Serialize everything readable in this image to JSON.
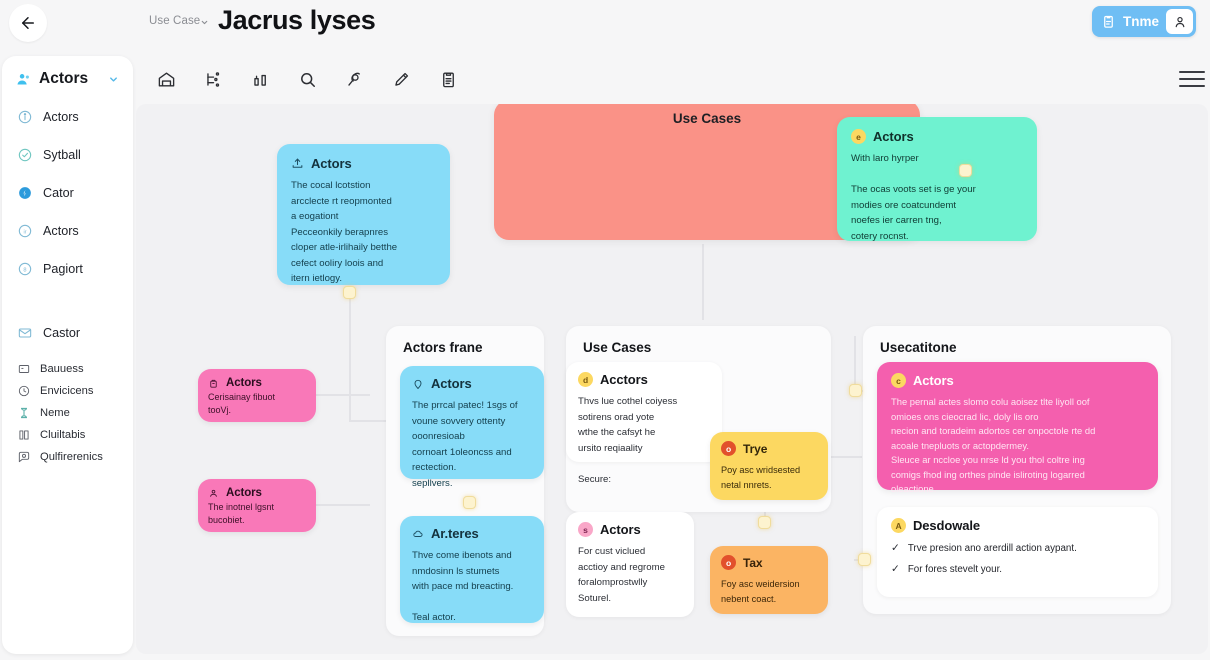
{
  "header": {
    "back_icon": "arrow-left-icon",
    "breadcrumb": "Use Case",
    "breadcrumb_caret": "chevron-down-icon",
    "title": "Jacrus lyses",
    "action_label": "Tnme",
    "action_icon": "clipboard-icon",
    "avatar_icon": "user-icon"
  },
  "toolbar": {
    "icons": [
      "home-icon",
      "sitemap-icon",
      "bar-chart-icon",
      "search-icon",
      "tag-icon",
      "pencil-icon",
      "clipboard-list-icon"
    ],
    "menu_icon": "hamburger-menu-icon"
  },
  "sidebar": {
    "header_label": "Actors",
    "header_icon": "user-group-icon",
    "header_caret": "chevron-down-icon",
    "items": [
      {
        "label": "Actors",
        "icon": "info-circle-icon",
        "active": false
      },
      {
        "label": "Sytball",
        "icon": "check-circle-icon",
        "active": false
      },
      {
        "label": "Cator",
        "icon": "filled-circle-icon",
        "active": true
      },
      {
        "label": "Actors",
        "icon": "letter-circle-icon",
        "active": false
      },
      {
        "label": "Pagiort",
        "icon": "number-circle-icon",
        "active": false
      }
    ],
    "secondary": [
      {
        "label": "Castor",
        "icon": "mail-icon"
      }
    ],
    "tertiary": [
      {
        "label": "Bauuess",
        "icon": "card-icon"
      },
      {
        "label": "Envicicens",
        "icon": "clock-icon"
      },
      {
        "label": "Neme",
        "icon": "hourglass-icon"
      },
      {
        "label": "Cluiltabis",
        "icon": "book-icon"
      },
      {
        "label": "Qulfirerenics",
        "icon": "comment-search-icon"
      }
    ]
  },
  "canvas": {
    "banner": {
      "title": "Use Cases"
    },
    "frames": [
      {
        "title": "Actors frane"
      },
      {
        "title": "Use Cases"
      },
      {
        "title": "Usecatitone"
      }
    ],
    "cards": {
      "blue_top": {
        "title": "Actors",
        "icon": "upload-icon",
        "body": "The cocal lcotstion\narcclecte rt reopmonted\na eogationt\nPecceonkily berapnres\ncloper atle-irlihaily betthe\ncefect ooliry loois and\nitern ietlogy."
      },
      "teal_top": {
        "title": "Actors",
        "icon": "badge-icon",
        "badge_char": "e",
        "body": "With laro hyrper\n\nThe ocas voots set is ge your\nmodies ore coatcundemt\nnoefes ier carren tng,\ncotery rocnst."
      },
      "pink_left_1": {
        "title": "Actors",
        "icon": "bag-icon",
        "body": "Cerisainay fibuot\ntooVj."
      },
      "pink_left_2": {
        "title": "Actors",
        "icon": "person-icon",
        "body": "The inotnel  lgsnt\nbucobiet."
      },
      "blue_mid_1": {
        "title": "Actors",
        "icon": "location-pin-icon",
        "body": "The prrcal patec! 1sgs of\nvoune sovvery ottenty\nooonresioab\ncornoart 1oleoncss and\nrectection.\nsepllvers."
      },
      "blue_mid_2": {
        "title": "Ar.teres",
        "icon": "cloud-icon",
        "body": "Thve come ibenots and\nnmdosinn ls stumets\nwith pace md breacting.\n\nTeal actor."
      },
      "usecase_1": {
        "title": "Acctors",
        "badge_char": "d",
        "body": "Thvs lue cothel coiyess\nsotirens orad yote\nwthe the cafsyt he\nursito reqiaality\n\nSecure:"
      },
      "usecase_2": {
        "title": "Actors",
        "badge_char": "s",
        "body": "For cust viclued\nacctioy and regrome\nforalomprostwlly\nSoturel."
      },
      "yellow_1": {
        "title": "Trye",
        "badge_char": "o",
        "body": "Poy asc wridsested\nnetal nnrets."
      },
      "orange_1": {
        "title": "Tax",
        "badge_char": "o",
        "body": "Foy asc weidersion\nnebent coact."
      },
      "pink_right": {
        "title": "Actors",
        "badge_char": "c",
        "body": "The pernal actes slomo colu aoisez tlte liyoll oof\nomioes ons cieocrad lic, doly lis oro\nnecion and toradeim adortos cer onpoctole rte dd\nacoale tnepluots or actopdermey.\nSleuce ar nccloe you nrse ld you thol coltre ing\ncomigs fhod ing orthes pinde isliroting logarred\noleactione."
      },
      "checklist": {
        "title": "Desdowale",
        "badge_char": "A",
        "items": [
          "Trve presion ano arerdill action aypant.",
          "For fores stevelt your."
        ]
      }
    }
  },
  "colors": {
    "blue": "#87dcf8",
    "teal": "#6ff2d0",
    "pink": "#f978b8",
    "pink_strong": "#f45fae",
    "salmon": "#fa9287",
    "yellow": "#fcd861",
    "orange": "#fbb463",
    "accent_blue": "#6fbef4",
    "handle": "#fdf3cf"
  }
}
